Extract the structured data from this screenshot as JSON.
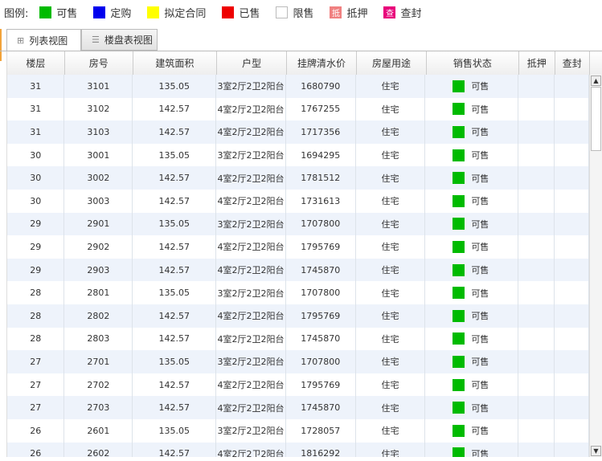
{
  "legend": {
    "title": "图例:",
    "items": [
      {
        "label": "可售",
        "color": "#00bb00",
        "glyph": ""
      },
      {
        "label": "定购",
        "color": "#0000ee",
        "glyph": ""
      },
      {
        "label": "拟定合同",
        "color": "#ffff00",
        "glyph": ""
      },
      {
        "label": "已售",
        "color": "#ee0000",
        "glyph": ""
      },
      {
        "label": "限售",
        "color": "#ffffff",
        "glyph": ""
      },
      {
        "label": "抵押",
        "color": "#f08080",
        "glyph": "抵"
      },
      {
        "label": "查封",
        "color": "#e8007a",
        "glyph": "查"
      }
    ]
  },
  "tabs": [
    {
      "label": "列表视图",
      "icon": "grid-icon"
    },
    {
      "label": "楼盘表视图",
      "icon": "list-icon"
    }
  ],
  "table": {
    "headers": [
      "楼层",
      "房号",
      "建筑面积",
      "户型",
      "挂牌清水价",
      "房屋用途",
      "销售状态",
      "抵押",
      "查封"
    ],
    "rows": [
      [
        "31",
        "3101",
        "135.05",
        "3室2厅2卫2阳台",
        "1680790",
        "住宅",
        "可售",
        "",
        ""
      ],
      [
        "31",
        "3102",
        "142.57",
        "4室2厅2卫2阳台",
        "1767255",
        "住宅",
        "可售",
        "",
        ""
      ],
      [
        "31",
        "3103",
        "142.57",
        "4室2厅2卫2阳台",
        "1717356",
        "住宅",
        "可售",
        "",
        ""
      ],
      [
        "30",
        "3001",
        "135.05",
        "3室2厅2卫2阳台",
        "1694295",
        "住宅",
        "可售",
        "",
        ""
      ],
      [
        "30",
        "3002",
        "142.57",
        "4室2厅2卫2阳台",
        "1781512",
        "住宅",
        "可售",
        "",
        ""
      ],
      [
        "30",
        "3003",
        "142.57",
        "4室2厅2卫2阳台",
        "1731613",
        "住宅",
        "可售",
        "",
        ""
      ],
      [
        "29",
        "2901",
        "135.05",
        "3室2厅2卫2阳台",
        "1707800",
        "住宅",
        "可售",
        "",
        ""
      ],
      [
        "29",
        "2902",
        "142.57",
        "4室2厅2卫2阳台",
        "1795769",
        "住宅",
        "可售",
        "",
        ""
      ],
      [
        "29",
        "2903",
        "142.57",
        "4室2厅2卫2阳台",
        "1745870",
        "住宅",
        "可售",
        "",
        ""
      ],
      [
        "28",
        "2801",
        "135.05",
        "3室2厅2卫2阳台",
        "1707800",
        "住宅",
        "可售",
        "",
        ""
      ],
      [
        "28",
        "2802",
        "142.57",
        "4室2厅2卫2阳台",
        "1795769",
        "住宅",
        "可售",
        "",
        ""
      ],
      [
        "28",
        "2803",
        "142.57",
        "4室2厅2卫2阳台",
        "1745870",
        "住宅",
        "可售",
        "",
        ""
      ],
      [
        "27",
        "2701",
        "135.05",
        "3室2厅2卫2阳台",
        "1707800",
        "住宅",
        "可售",
        "",
        ""
      ],
      [
        "27",
        "2702",
        "142.57",
        "4室2厅2卫2阳台",
        "1795769",
        "住宅",
        "可售",
        "",
        ""
      ],
      [
        "27",
        "2703",
        "142.57",
        "4室2厅2卫2阳台",
        "1745870",
        "住宅",
        "可售",
        "",
        ""
      ],
      [
        "26",
        "2601",
        "135.05",
        "3室2厅2卫2阳台",
        "1728057",
        "住宅",
        "可售",
        "",
        ""
      ],
      [
        "26",
        "2602",
        "142.57",
        "4室2厅2卫2阳台",
        "1816292",
        "住宅",
        "可售",
        "",
        ""
      ]
    ]
  },
  "status_color": "#00bb00",
  "scrollbar": {
    "up_icon": "▲",
    "down_icon": "▼"
  }
}
